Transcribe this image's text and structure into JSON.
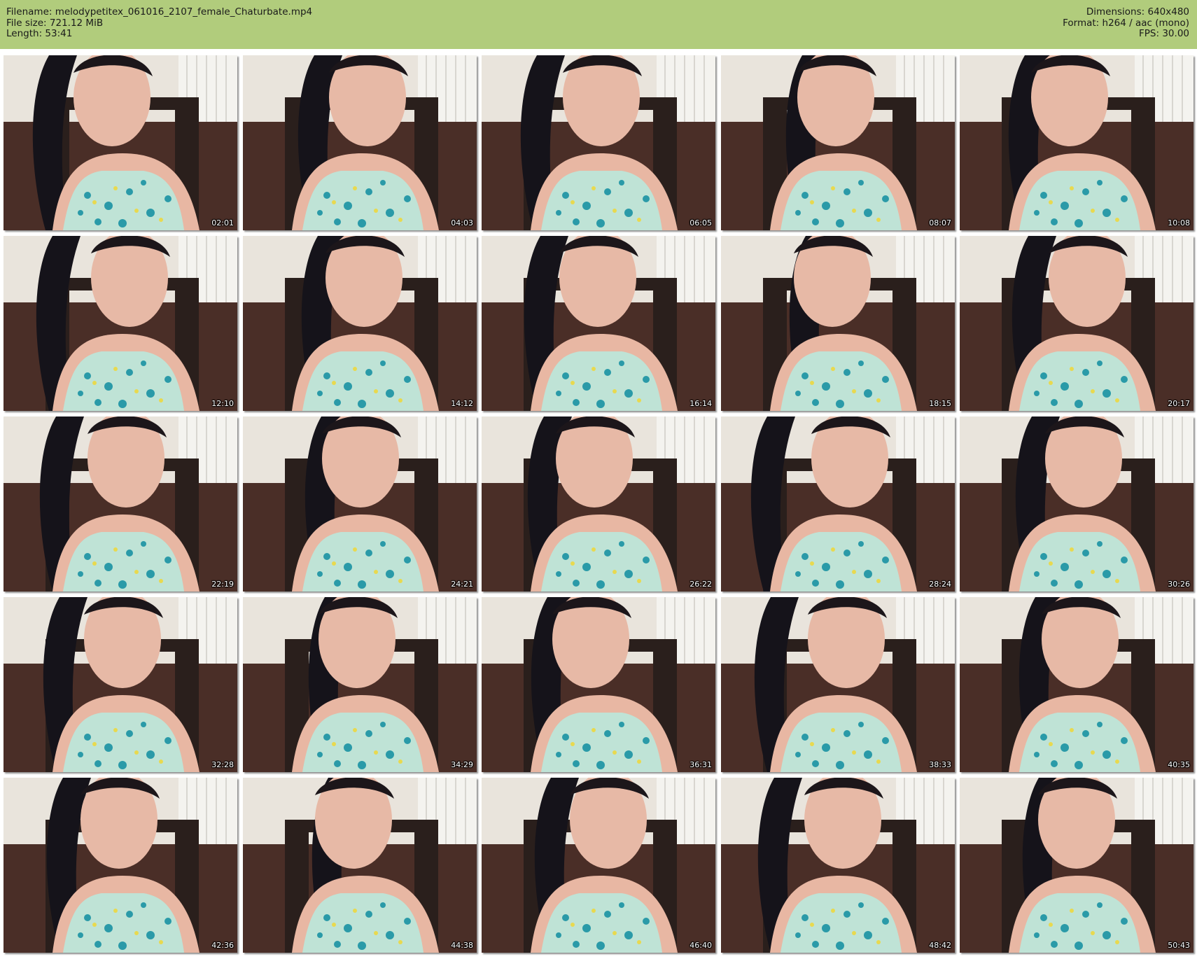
{
  "header": {
    "filename_line": "Filename: melodypetitex_061016_2107_female_Chaturbate.mp4",
    "filesize_line": "File size: 721.12 MiB",
    "length_line": "Length: 53:41",
    "dimensions_line": "Dimensions: 640x480",
    "format_line": "Format: h264 / aac (mono)",
    "fps_line": "FPS: 30.00",
    "background_color": "#b1cc7c"
  },
  "thumbnails": [
    {
      "timestamp": "02:01"
    },
    {
      "timestamp": "04:03"
    },
    {
      "timestamp": "06:05"
    },
    {
      "timestamp": "08:07"
    },
    {
      "timestamp": "10:08"
    },
    {
      "timestamp": "12:10"
    },
    {
      "timestamp": "14:12"
    },
    {
      "timestamp": "16:14"
    },
    {
      "timestamp": "18:15"
    },
    {
      "timestamp": "20:17"
    },
    {
      "timestamp": "22:19"
    },
    {
      "timestamp": "24:21"
    },
    {
      "timestamp": "26:22"
    },
    {
      "timestamp": "28:24"
    },
    {
      "timestamp": "30:26"
    },
    {
      "timestamp": "32:28"
    },
    {
      "timestamp": "34:29"
    },
    {
      "timestamp": "36:31"
    },
    {
      "timestamp": "38:33"
    },
    {
      "timestamp": "40:35"
    },
    {
      "timestamp": "42:36"
    },
    {
      "timestamp": "44:38"
    },
    {
      "timestamp": "46:40"
    },
    {
      "timestamp": "48:42"
    },
    {
      "timestamp": "50:43"
    }
  ]
}
